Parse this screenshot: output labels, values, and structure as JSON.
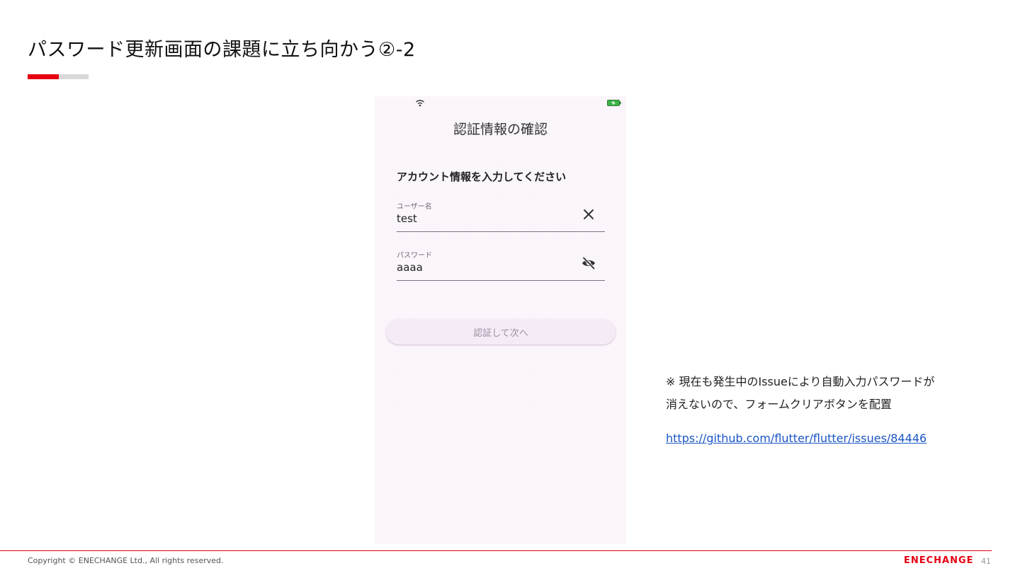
{
  "slide": {
    "title": "パスワード更新画面の課題に立ち向かう②-2"
  },
  "phone": {
    "screen_title": "認証情報の確認",
    "section_heading": "アカウント情報を入力してください",
    "username": {
      "label": "ユーザー名",
      "value": "test"
    },
    "password": {
      "label": "パスワード",
      "value": "aaaa"
    },
    "submit_label": "認証して次へ",
    "icons": {
      "status": [
        "wifi-icon",
        "battery-charging-icon"
      ],
      "username_action": "close-icon",
      "password_action": "visibility-off-icon"
    }
  },
  "note": {
    "line1": "※ 現在も発生中のIssueにより自動入力パスワードが",
    "line2": "消えないので、フォームクリアボタンを配置",
    "link": "https://github.com/flutter/flutter/issues/84446"
  },
  "footer": {
    "copyright": "Copyright © ENECHANGE Ltd., All rights reserved.",
    "logo": "ENECHANGE",
    "page_number": "41"
  },
  "colors": {
    "brand_red": "#e60012",
    "link_blue": "#1a55c4",
    "phone_background": "#fcf7fc",
    "button_background": "#f5ebf6"
  }
}
